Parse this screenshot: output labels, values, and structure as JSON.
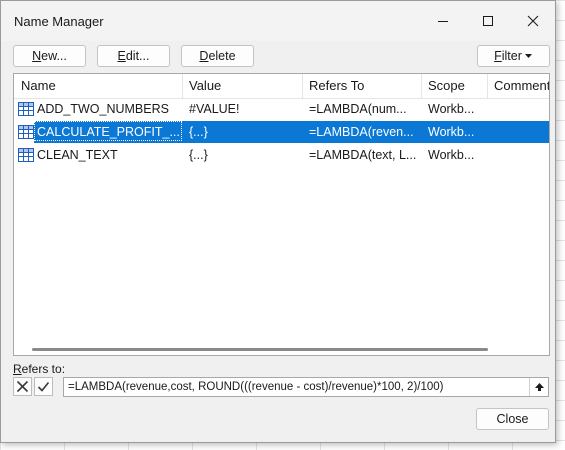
{
  "window": {
    "title": "Name Manager"
  },
  "toolbar": {
    "new_label": "New...",
    "edit_label": "Edit...",
    "delete_label": "Delete",
    "filter_label": "Filter"
  },
  "list": {
    "columns": [
      "Name",
      "Value",
      "Refers To",
      "Scope",
      "Comment"
    ],
    "rows": [
      {
        "name": "ADD_TWO_NUMBERS",
        "value": "#VALUE!",
        "refers_to": "=LAMBDA(num...",
        "scope": "Workb...",
        "selected": false
      },
      {
        "name": "CALCULATE_PROFIT_...",
        "value": "{...}",
        "refers_to": "=LAMBDA(reven...",
        "scope": "Workb...",
        "selected": true
      },
      {
        "name": "CLEAN_TEXT",
        "value": "{...}",
        "refers_to": "=LAMBDA(text, L...",
        "scope": "Workb...",
        "selected": false
      }
    ]
  },
  "refers_to": {
    "label": "Refers to:",
    "formula": "=LAMBDA(revenue,cost, ROUND(((revenue - cost)/revenue)*100, 2)/100)"
  },
  "footer": {
    "close_label": "Close"
  },
  "colors": {
    "selection": "#0a78d4",
    "icon_blue": "#1f5fbf"
  }
}
